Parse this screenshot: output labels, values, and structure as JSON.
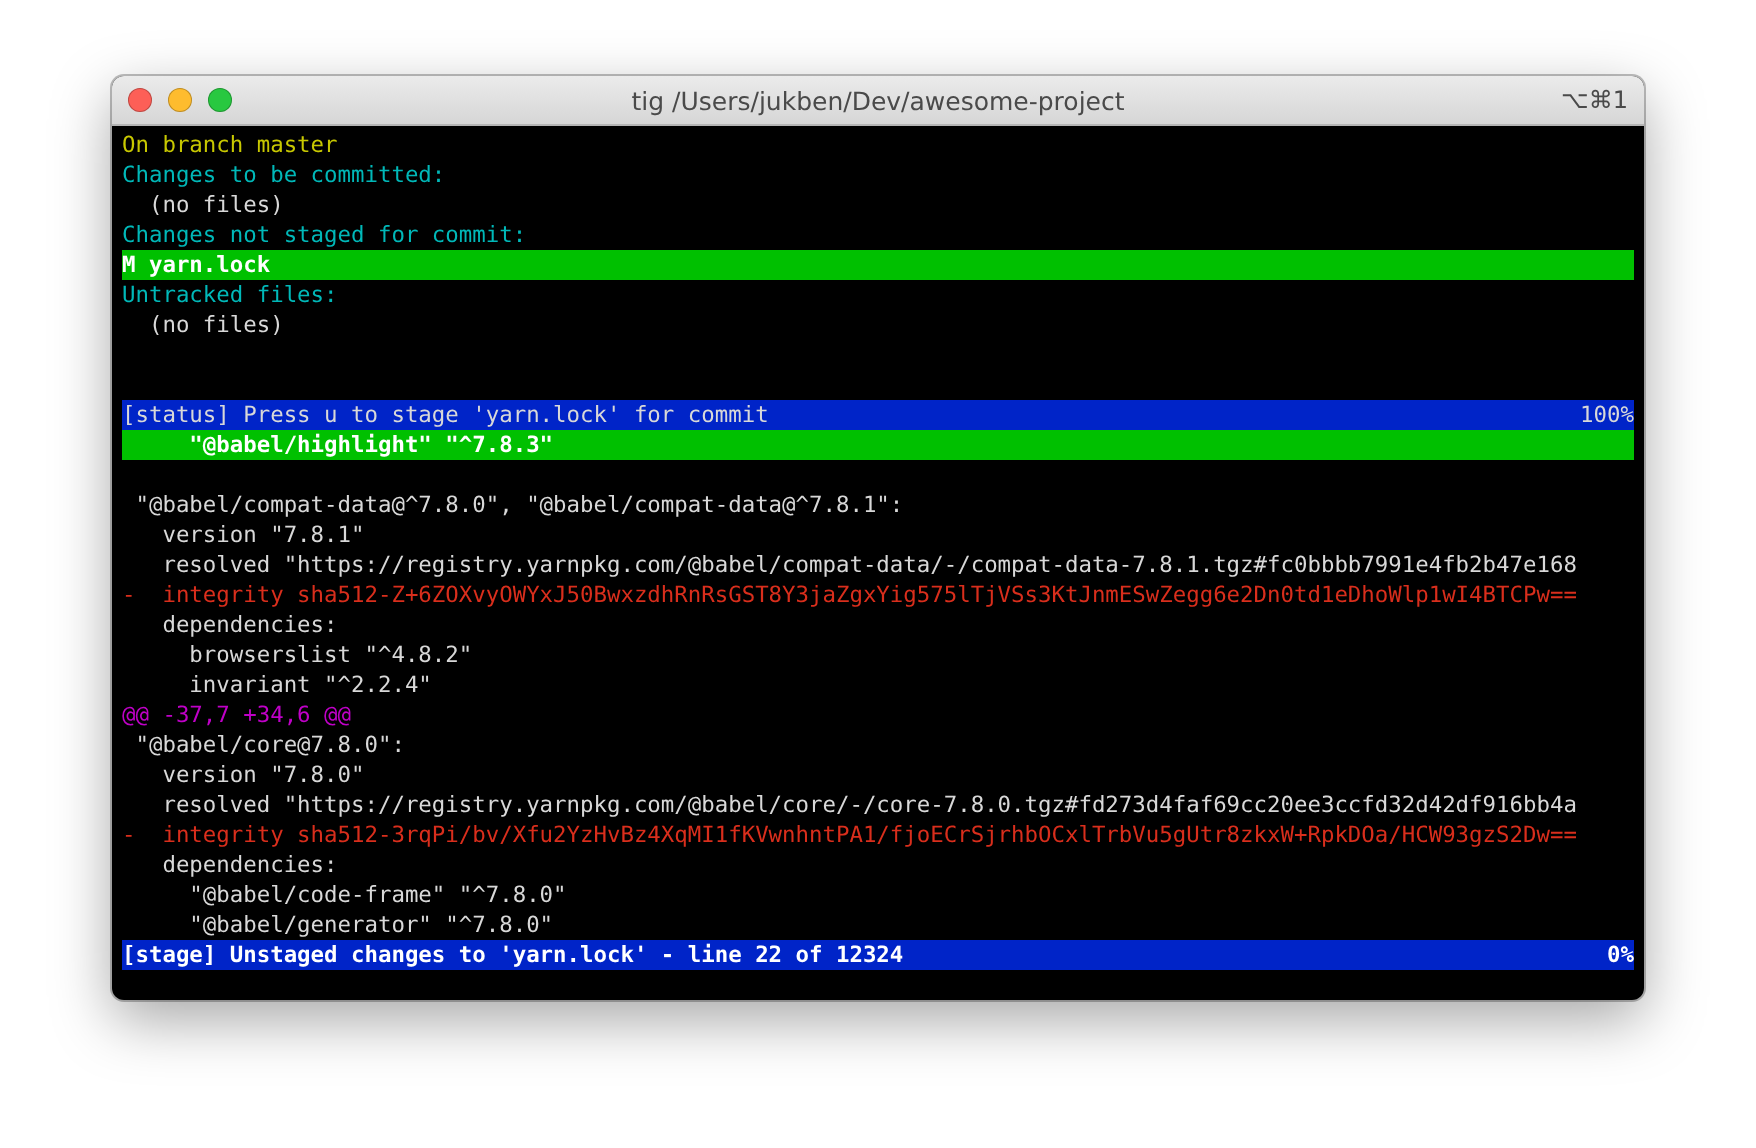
{
  "window": {
    "title": "tig /Users/jukben/Dev/awesome-project",
    "shortcut": "⌥⌘1"
  },
  "status_view": {
    "lines": [
      {
        "kind": "branch",
        "text": "On branch master"
      },
      {
        "kind": "section",
        "text": "Changes to be committed:"
      },
      {
        "kind": "plain",
        "text": "  (no files)"
      },
      {
        "kind": "section",
        "text": "Changes not staged for commit:"
      },
      {
        "kind": "file",
        "text": "M yarn.lock",
        "selected": true
      },
      {
        "kind": "section",
        "text": "Untracked files:"
      },
      {
        "kind": "plain",
        "text": "  (no files)"
      }
    ]
  },
  "status_bar": {
    "text": "[status] Press u to stage 'yarn.lock' for commit",
    "percent": "100%"
  },
  "diff_view": {
    "lines": [
      {
        "kind": "cursor",
        "text": "     \"@babel/highlight\" \"^7.8.3\""
      },
      {
        "kind": "context",
        "text": " \"@babel/compat-data@^7.8.0\", \"@babel/compat-data@^7.8.1\":"
      },
      {
        "kind": "context",
        "text": "   version \"7.8.1\""
      },
      {
        "kind": "context",
        "text": "   resolved \"https://registry.yarnpkg.com/@babel/compat-data/-/compat-data-7.8.1.tgz#fc0bbbb7991e4fb2b47e168"
      },
      {
        "kind": "removed",
        "text": "-  integrity sha512-Z+6ZOXvyOWYxJ50BwxzdhRnRsGST8Y3jaZgxYig575lTjVSs3KtJnmESwZegg6e2Dn0td1eDhoWlp1wI4BTCPw=="
      },
      {
        "kind": "context",
        "text": "   dependencies:"
      },
      {
        "kind": "context",
        "text": "     browserslist \"^4.8.2\""
      },
      {
        "kind": "context",
        "text": "     invariant \"^2.2.4\""
      },
      {
        "kind": "hunk",
        "text": "@@ -37,7 +34,6 @@"
      },
      {
        "kind": "context",
        "text": " \"@babel/core@7.8.0\":"
      },
      {
        "kind": "context",
        "text": "   version \"7.8.0\""
      },
      {
        "kind": "context",
        "text": "   resolved \"https://registry.yarnpkg.com/@babel/core/-/core-7.8.0.tgz#fd273d4faf69cc20ee3ccfd32d42df916bb4a"
      },
      {
        "kind": "removed",
        "text": "-  integrity sha512-3rqPi/bv/Xfu2YzHvBz4XqMI1fKVwnhntPA1/fjoECrSjrhbOCxlTrbVu5gUtr8zkxW+RpkDOa/HCW93gzS2Dw=="
      },
      {
        "kind": "context",
        "text": "   dependencies:"
      },
      {
        "kind": "context",
        "text": "     \"@babel/code-frame\" \"^7.8.0\""
      },
      {
        "kind": "context",
        "text": "     \"@babel/generator\" \"^7.8.0\""
      }
    ]
  },
  "stage_bar": {
    "text": "[stage] Unstaged changes to 'yarn.lock' - line 22 of 12324",
    "percent": "0%"
  }
}
